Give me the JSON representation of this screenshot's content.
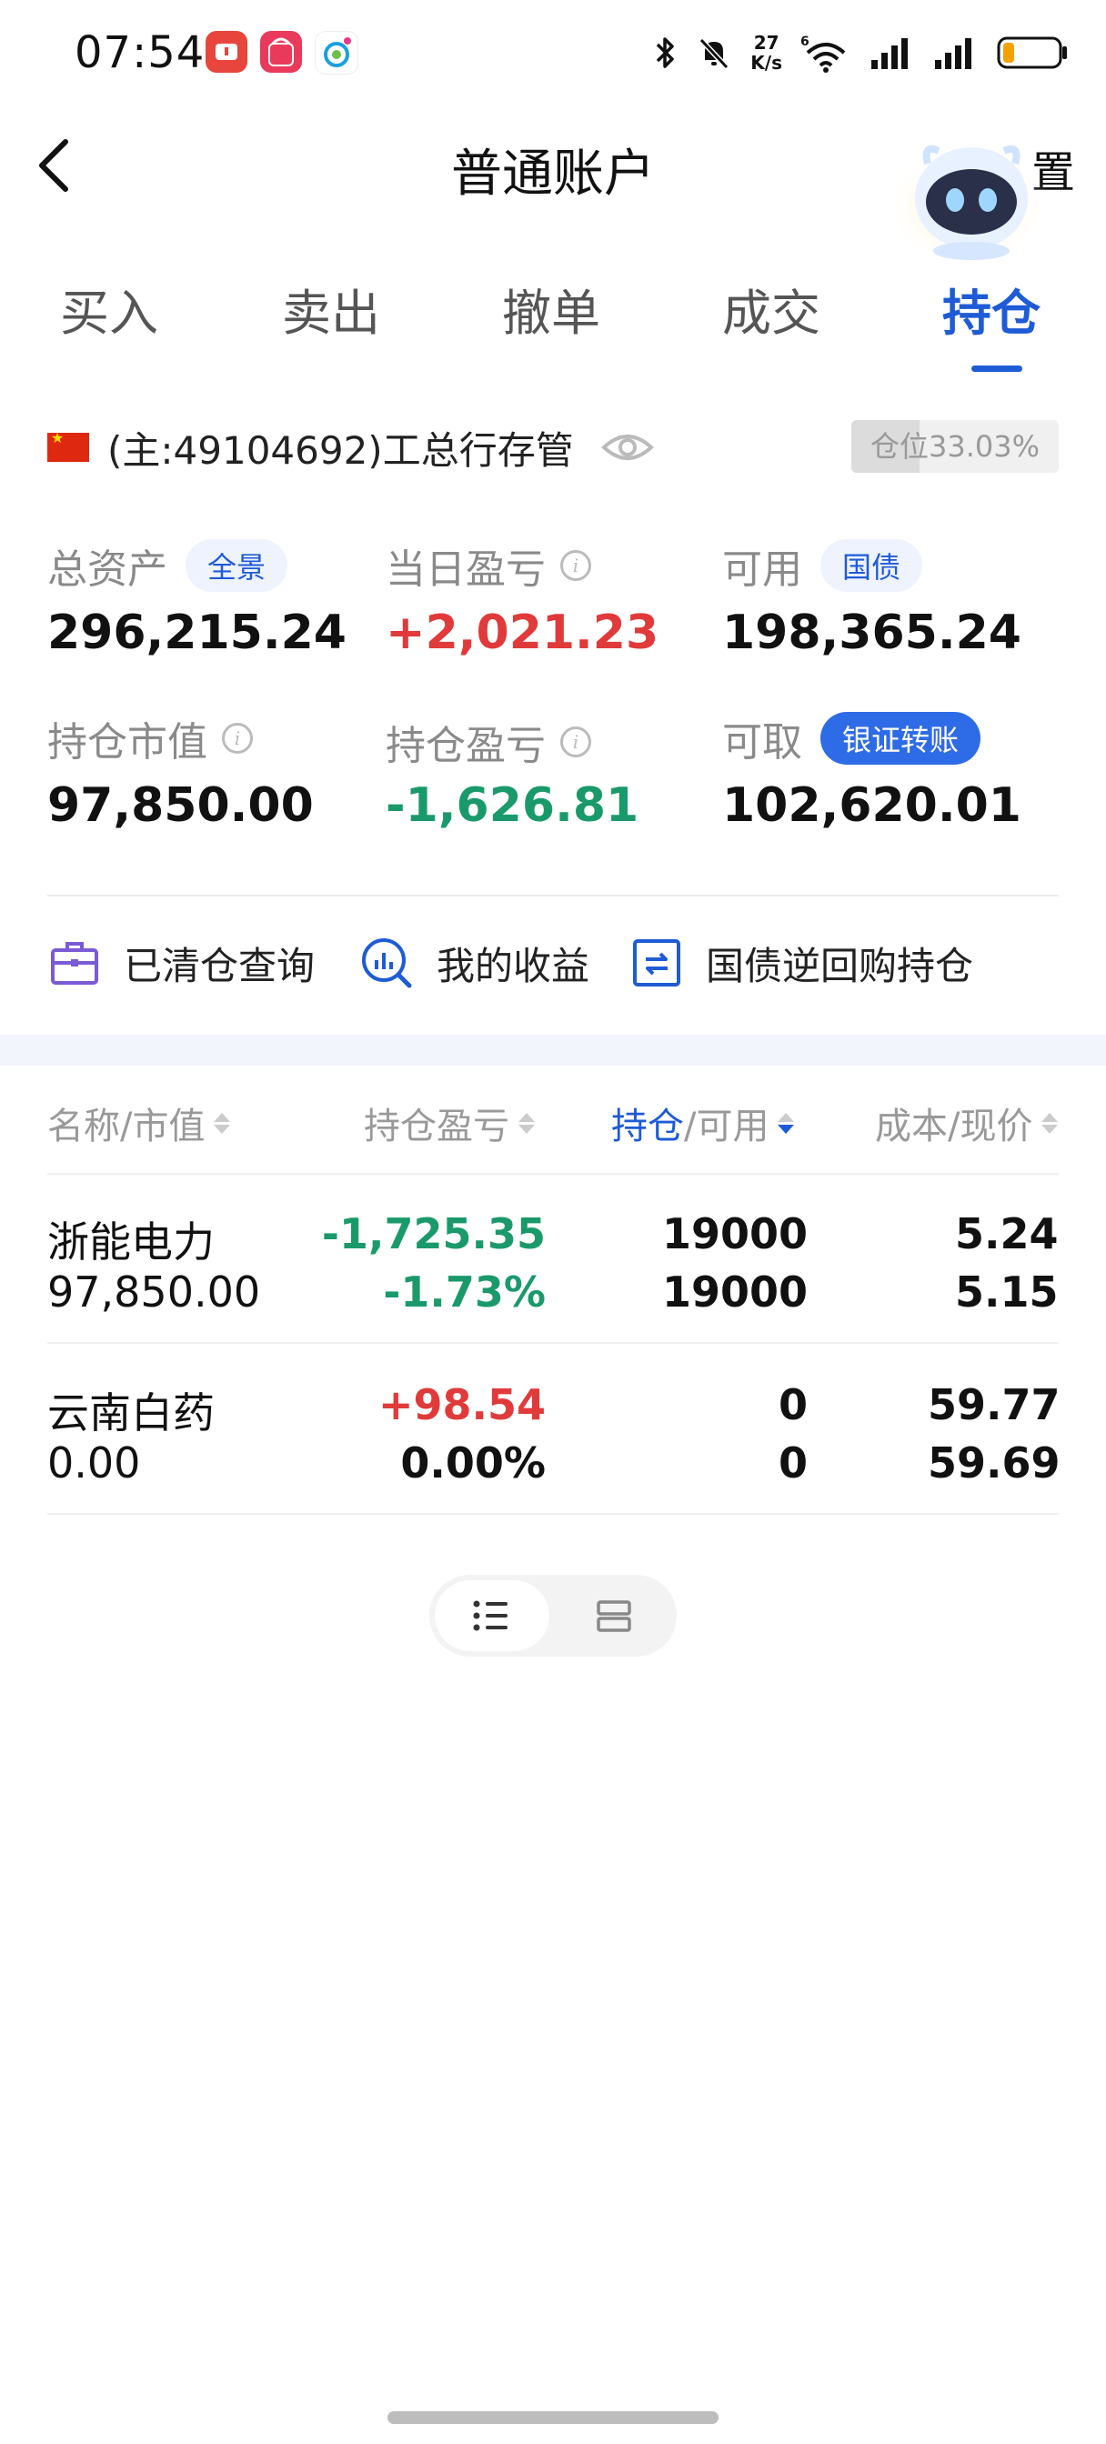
{
  "status_bar": {
    "time": "07:54",
    "net_speed_top": "27",
    "net_speed_bottom": "K/s",
    "wifi_tag": "6",
    "battery_level": 0.2
  },
  "header": {
    "title": "普通账户",
    "settings_partial": "置"
  },
  "tabs": [
    {
      "label": "买入"
    },
    {
      "label": "卖出"
    },
    {
      "label": "撤单"
    },
    {
      "label": "成交"
    },
    {
      "label": "持仓",
      "active": true
    }
  ],
  "account": {
    "label": "(主:49104692)工总行存管",
    "position_ratio_label": "仓位33.03%",
    "position_ratio": 0.3303
  },
  "summary": {
    "total_assets": {
      "label": "总资产",
      "tag": "全景",
      "value": "296,215.24"
    },
    "daily_pnl": {
      "label": "当日盈亏",
      "value": "+2,021.23"
    },
    "available": {
      "label": "可用",
      "tag": "国债",
      "value": "198,365.24"
    },
    "market_value": {
      "label": "持仓市值",
      "value": "97,850.00"
    },
    "holding_pnl": {
      "label": "持仓盈亏",
      "value": "-1,626.81"
    },
    "withdrawable": {
      "label": "可取",
      "tag": "银证转账",
      "value": "102,620.01"
    }
  },
  "quick_links": [
    {
      "label": "已清仓查询",
      "icon": "briefcase-icon"
    },
    {
      "label": "我的收益",
      "icon": "chart-search-icon"
    },
    {
      "label": "国债逆回购持仓",
      "icon": "repo-icon"
    }
  ],
  "table": {
    "headers": {
      "name": "名称/市值",
      "pnl": "持仓盈亏",
      "hold_active": "持仓",
      "hold_rest": "/可用",
      "cost": "成本/现价"
    },
    "rows": [
      {
        "name": "浙能电力",
        "market_value": "97,850.00",
        "pnl": "-1,725.35",
        "pnl_pct": "-1.73%",
        "hold": "19000",
        "avail": "19000",
        "cost": "5.241",
        "price": "5.150"
      },
      {
        "name": "云南白药",
        "market_value": "0.00",
        "pnl": "+98.54",
        "pnl_pct": "0.00%",
        "hold": "0",
        "avail": "0",
        "cost": "59.770",
        "price": "59.690"
      }
    ]
  },
  "colors": {
    "accent": "#1e5bd6",
    "up": "#e03a3a",
    "down": "#1a9a6b"
  }
}
